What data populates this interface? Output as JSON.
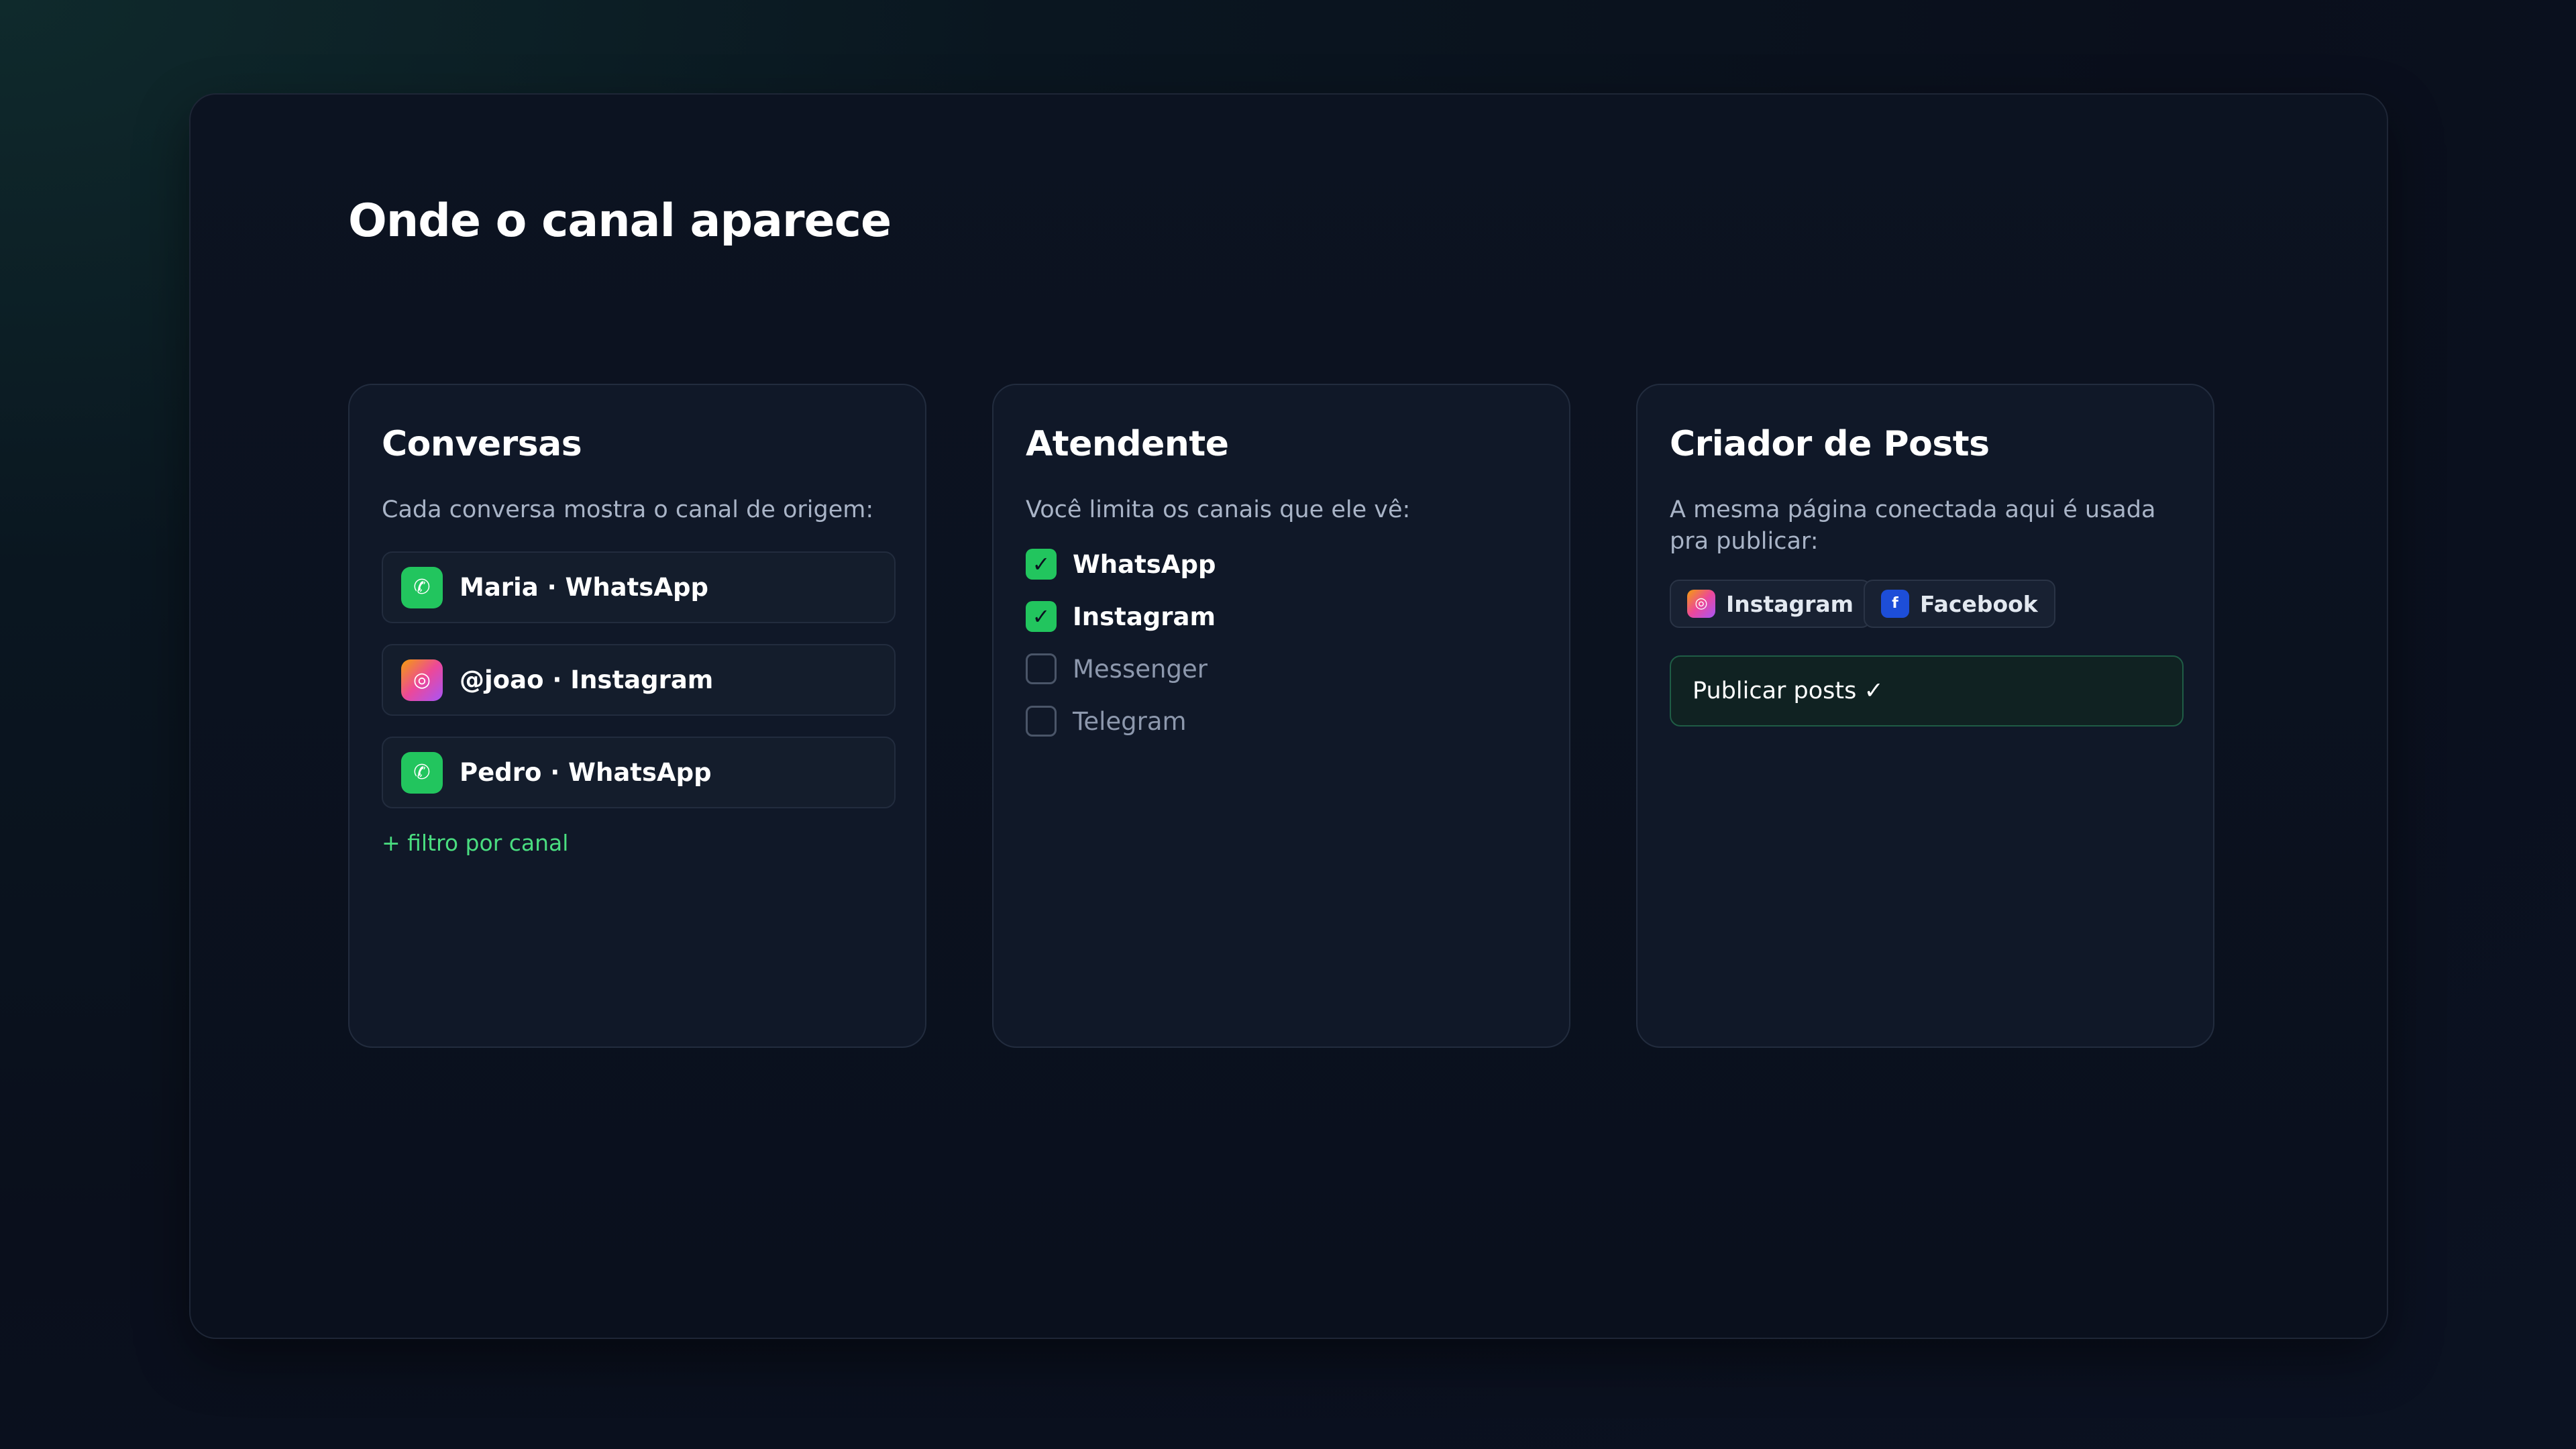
{
  "page": {
    "title": "Onde o canal aparece"
  },
  "colors": {
    "accent_green": "#22c55e",
    "link_green": "#4ade80",
    "card_bg": "#101828",
    "facebook_blue": "#1d4ed8"
  },
  "conversas": {
    "title": "Conversas",
    "subtitle": "Cada conversa mostra o canal de origem:",
    "items": [
      {
        "label": "Maria · WhatsApp",
        "icon": "whatsapp-icon"
      },
      {
        "label": "@joao · Instagram",
        "icon": "instagram-icon"
      },
      {
        "label": "Pedro · WhatsApp",
        "icon": "whatsapp-icon"
      }
    ],
    "filter_link": "+ filtro por canal"
  },
  "atendente": {
    "title": "Atendente",
    "subtitle": "Você limita os canais que ele vê:",
    "channels": [
      {
        "label": "WhatsApp",
        "checked": true,
        "mark": "✓"
      },
      {
        "label": "Instagram",
        "checked": true,
        "mark": "✓"
      },
      {
        "label": "Messenger",
        "checked": false
      },
      {
        "label": "Telegram",
        "checked": false
      }
    ]
  },
  "criador": {
    "title": "Criador de Posts",
    "subtitle": "A mesma página conectada aqui é usada pra publicar:",
    "pills": [
      {
        "label": "Instagram",
        "icon": "instagram-icon"
      },
      {
        "label": "Facebook",
        "icon": "facebook-icon",
        "glyph": "f"
      }
    ],
    "publish_label": "Publicar posts ✓"
  }
}
